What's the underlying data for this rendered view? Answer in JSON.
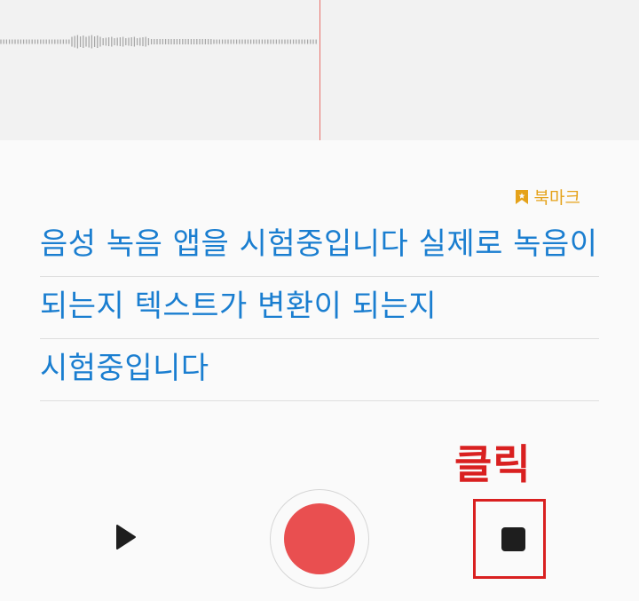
{
  "bookmark": {
    "label": "북마크",
    "icon": "bookmark-icon",
    "color": "#e5a21a"
  },
  "transcript": {
    "lines": [
      "음성 녹음 앱을 시험중입니다 실제로 녹음이",
      "되는지 텍스트가 변환이 되는지",
      "시험중입니다"
    ],
    "text_color": "#1a7ed0"
  },
  "controls": {
    "play_icon": "play-icon",
    "record_icon": "record-icon",
    "stop_icon": "stop-icon",
    "record_color": "#e94f50"
  },
  "annotation": {
    "label": "클릭",
    "color": "#d92020"
  }
}
